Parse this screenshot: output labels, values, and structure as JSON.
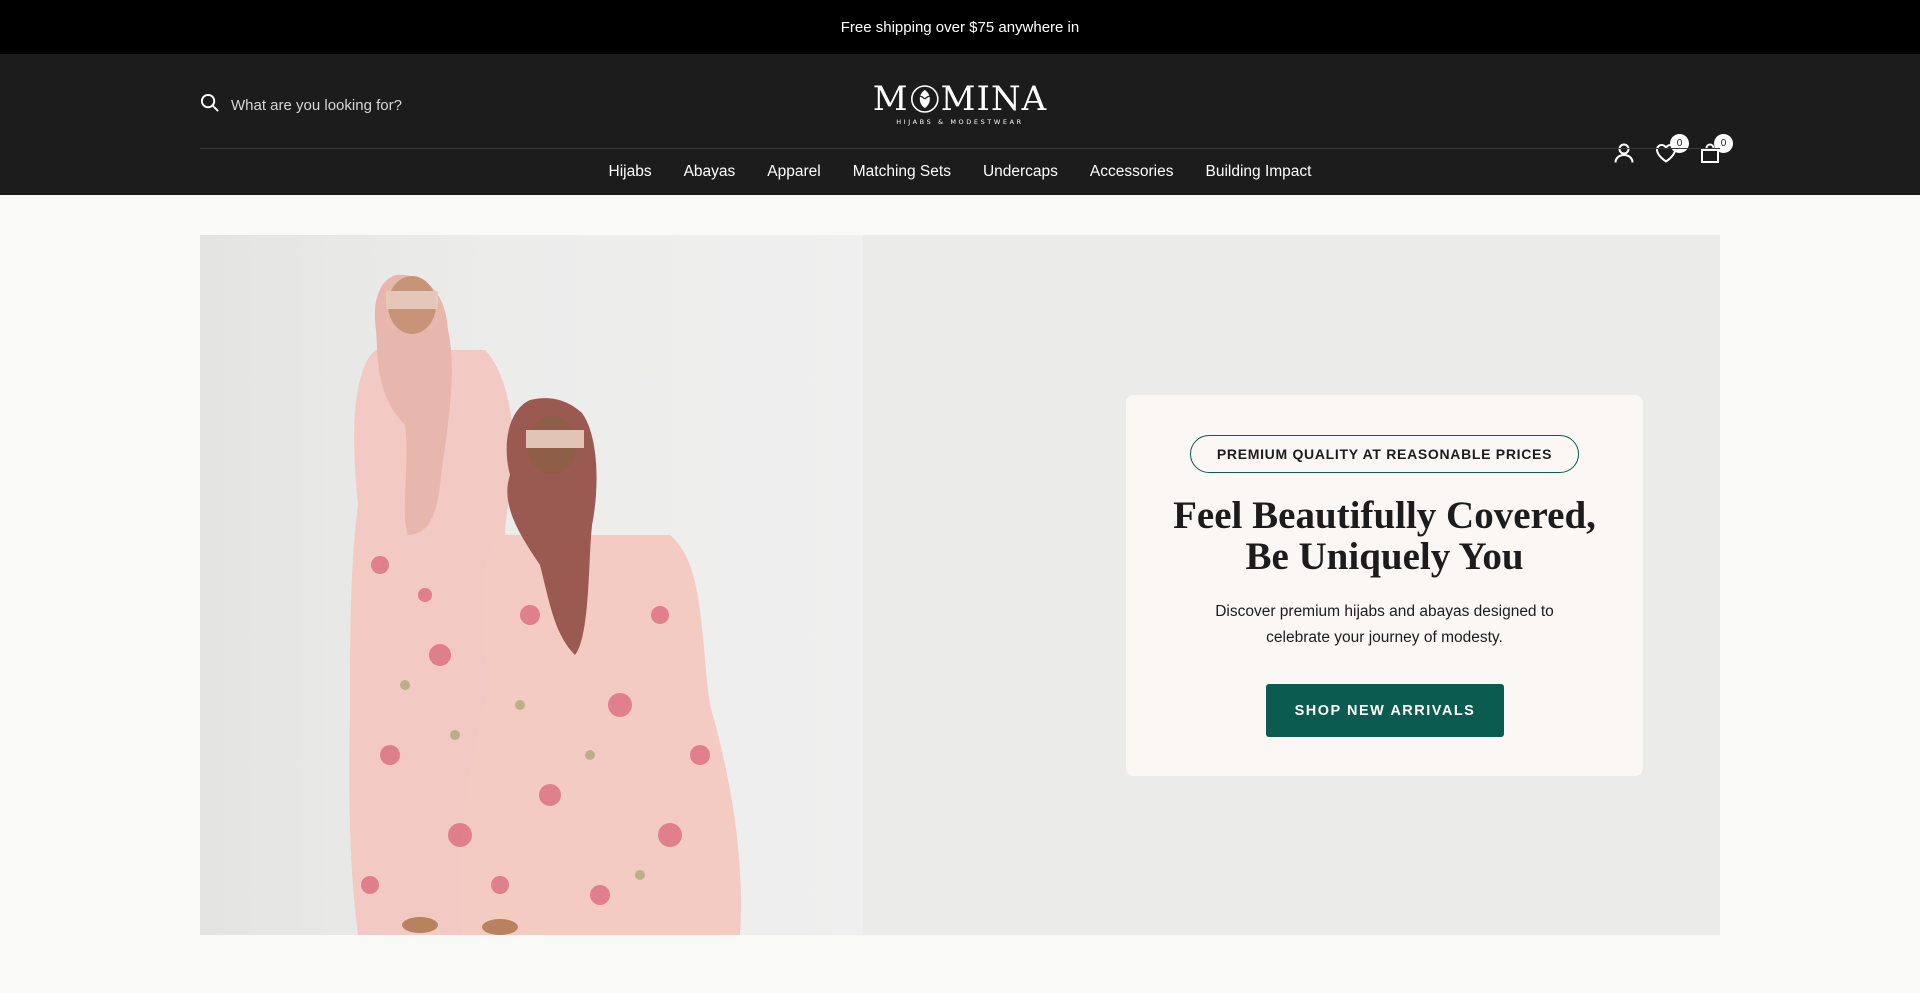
{
  "announcement": {
    "text": "Free shipping over $75 anywhere in"
  },
  "header": {
    "search": {
      "placeholder": "What are you looking for?"
    },
    "logo": {
      "name": "MOMINA",
      "tagline": "HIJABS & MODESTWEAR"
    },
    "wishlist_count": "0",
    "cart_count": "0"
  },
  "nav": {
    "items": [
      {
        "label": "Hijabs"
      },
      {
        "label": "Abayas"
      },
      {
        "label": "Apparel"
      },
      {
        "label": "Matching Sets"
      },
      {
        "label": "Undercaps"
      },
      {
        "label": "Accessories"
      },
      {
        "label": "Building Impact"
      }
    ]
  },
  "hero": {
    "badge": "PREMIUM QUALITY AT REASONABLE PRICES",
    "headline_line1": "Feel Beautifully Covered,",
    "headline_line2": "Be Uniquely You",
    "subtext_line1": "Discover premium hijabs and abayas designed to",
    "subtext_line2": "celebrate your journey of modesty.",
    "cta_label": "SHOP NEW ARRIVALS"
  },
  "colors": {
    "announcement_bg": "#000000",
    "header_bg": "#1c1c1c",
    "accent_green": "#0b5b50",
    "hero_bg": "#ebebe9",
    "card_bg": "#faf7f4"
  },
  "icons": [
    "search-icon",
    "rose-logo-icon",
    "account-icon",
    "heart-icon",
    "bag-icon"
  ]
}
